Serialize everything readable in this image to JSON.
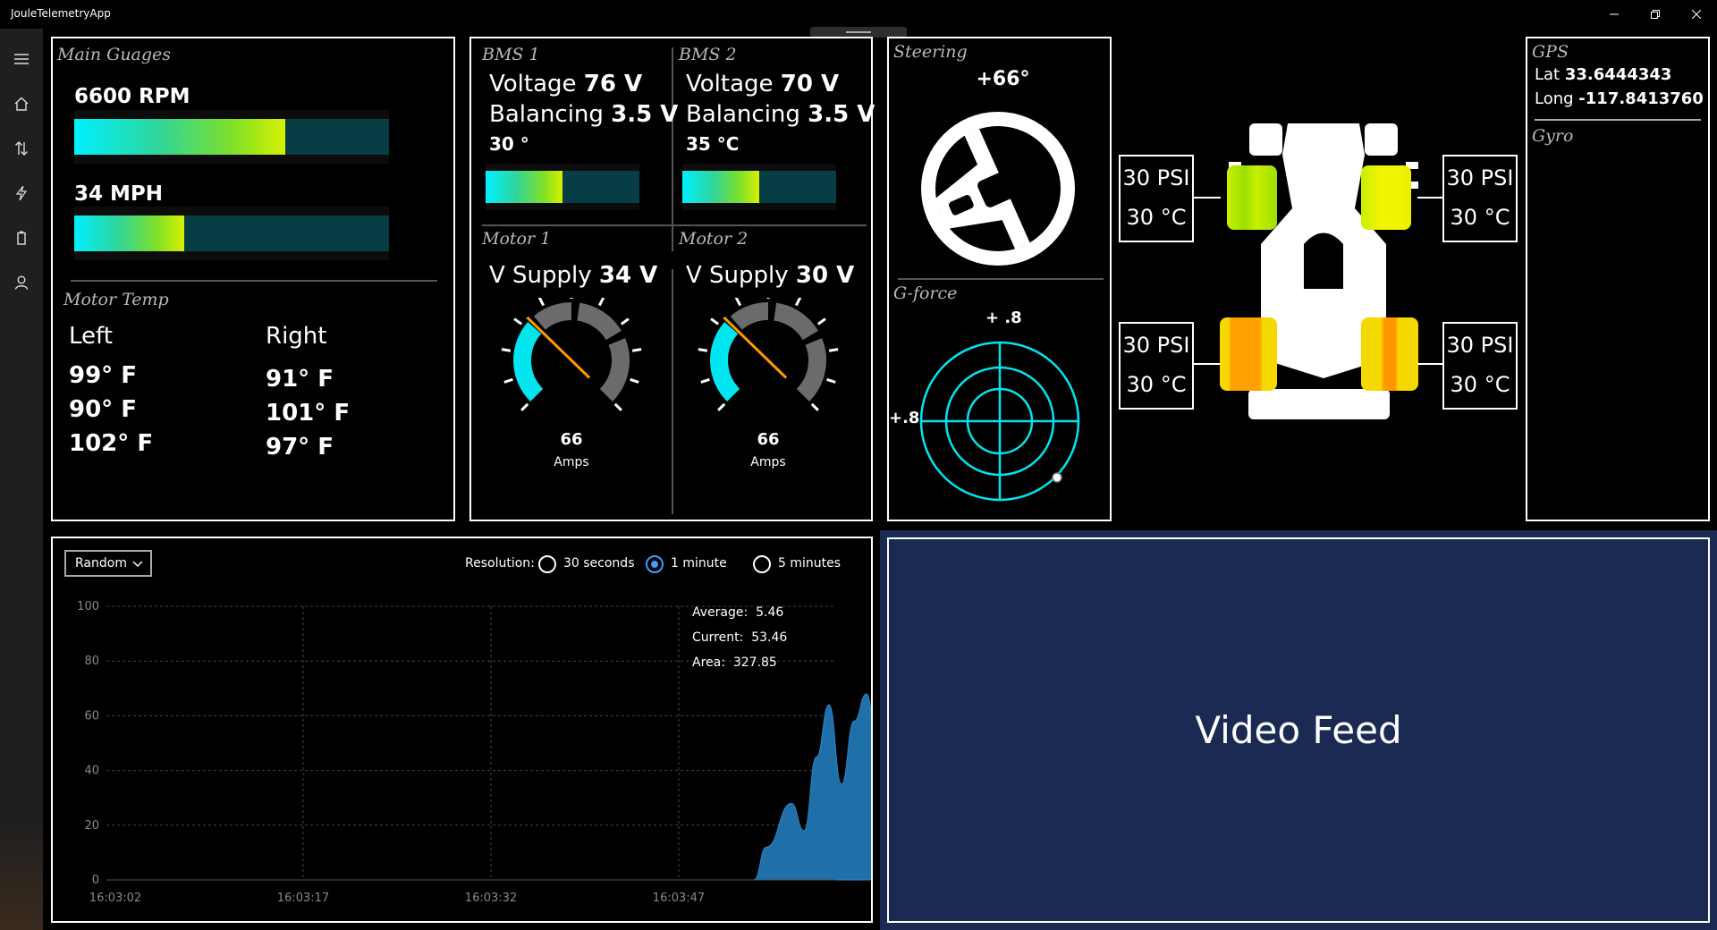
{
  "app": {
    "title": "JouleTelemetryApp"
  },
  "sidebar": {
    "items": [
      {
        "icon": "hamburger-icon"
      },
      {
        "icon": "home-icon"
      },
      {
        "icon": "swap-arrows-icon"
      },
      {
        "icon": "lightning-icon"
      },
      {
        "icon": "battery-icon"
      },
      {
        "icon": "person-icon"
      }
    ]
  },
  "main_gauges": {
    "title": "Main Guages",
    "rpm_label": "6600 RPM",
    "rpm_fraction": 0.67,
    "speed_label": "34 MPH",
    "speed_fraction": 0.35
  },
  "motor_temp": {
    "title": "Motor Temp",
    "left_header": "Left",
    "right_header": "Right",
    "left_values": [
      "99° F",
      "90° F",
      "102° F"
    ],
    "right_values": [
      "91° F",
      "101° F",
      "97° F"
    ]
  },
  "bms1": {
    "title": "BMS 1",
    "voltage_label": "Voltage",
    "voltage_value": "76 V",
    "balancing_label": "Balancing",
    "balancing_value": "3.5 V",
    "temp": "30 °",
    "bar_fraction": 0.5
  },
  "bms2": {
    "title": "BMS 2",
    "voltage_label": "Voltage",
    "voltage_value": "70 V",
    "balancing_label": "Balancing",
    "balancing_value": "3.5 V",
    "temp": "35 °C",
    "bar_fraction": 0.5
  },
  "motor1": {
    "title": "Motor 1",
    "supply_label": "V Supply",
    "supply_value": "34 V",
    "amps_value": "66",
    "amps_unit": "Amps",
    "gauge_fraction": 0.33
  },
  "motor2": {
    "title": "Motor 2",
    "supply_label": "V Supply",
    "supply_value": "30 V",
    "amps_value": "66",
    "amps_unit": "Amps",
    "gauge_fraction": 0.33
  },
  "steering": {
    "title": "Steering",
    "angle": "+66°"
  },
  "gforce": {
    "title": "G-force",
    "top_label": "+ .8",
    "left_label": "+.8"
  },
  "tires": {
    "front_left": {
      "pressure": "30 PSI",
      "temp": "30 °C"
    },
    "front_right": {
      "pressure": "30 PSI",
      "temp": "30 °C"
    },
    "rear_left": {
      "pressure": "30 PSI",
      "temp": "30 °C"
    },
    "rear_right": {
      "pressure": "30 PSI",
      "temp": "30 °C"
    }
  },
  "gps": {
    "title": "GPS",
    "lat_label": "Lat",
    "lat_value": "33.6444343",
    "long_label": "Long",
    "long_value": "-117.8413760"
  },
  "gyro": {
    "title": "Gyro"
  },
  "chart_controls": {
    "dropdown_value": "Random",
    "resolution_label": "Resolution:",
    "options": [
      "30 seconds",
      "1 minute",
      "5 minutes"
    ],
    "selected": "1 minute"
  },
  "stats": {
    "average_label": "Average:",
    "average_value": "5.46",
    "current_label": "Current:",
    "current_value": "53.46",
    "area_label": "Area:",
    "area_value": "327.85"
  },
  "video": {
    "label": "Video Feed"
  },
  "chart_data": {
    "type": "area",
    "x": [
      "16:03:02",
      "16:03:06",
      "16:03:10",
      "16:03:14",
      "16:03:17",
      "16:03:21",
      "16:03:25",
      "16:03:28",
      "16:03:32",
      "16:03:36",
      "16:03:40",
      "16:03:43",
      "16:03:47",
      "16:03:51",
      "16:03:53",
      "16:03:54",
      "16:03:56",
      "16:03:57",
      "16:03:58",
      "16:03:59",
      "16:04:00",
      "16:04:01",
      "16:04:02",
      "16:04:03",
      "16:04:04",
      "16:04:05"
    ],
    "values": [
      0,
      0,
      0,
      0,
      0,
      0,
      0,
      0,
      0,
      0,
      0,
      0,
      0,
      0,
      0,
      12,
      28,
      18,
      45,
      64,
      35,
      58,
      68,
      40,
      48,
      53
    ],
    "x_ticks": [
      "16:03:02",
      "16:03:17",
      "16:03:32",
      "16:03:47"
    ],
    "y_ticks": [
      "0",
      "20",
      "40",
      "60",
      "80",
      "100"
    ],
    "ylim": [
      0,
      100
    ],
    "grid": true,
    "color": "#1f6fa8"
  }
}
